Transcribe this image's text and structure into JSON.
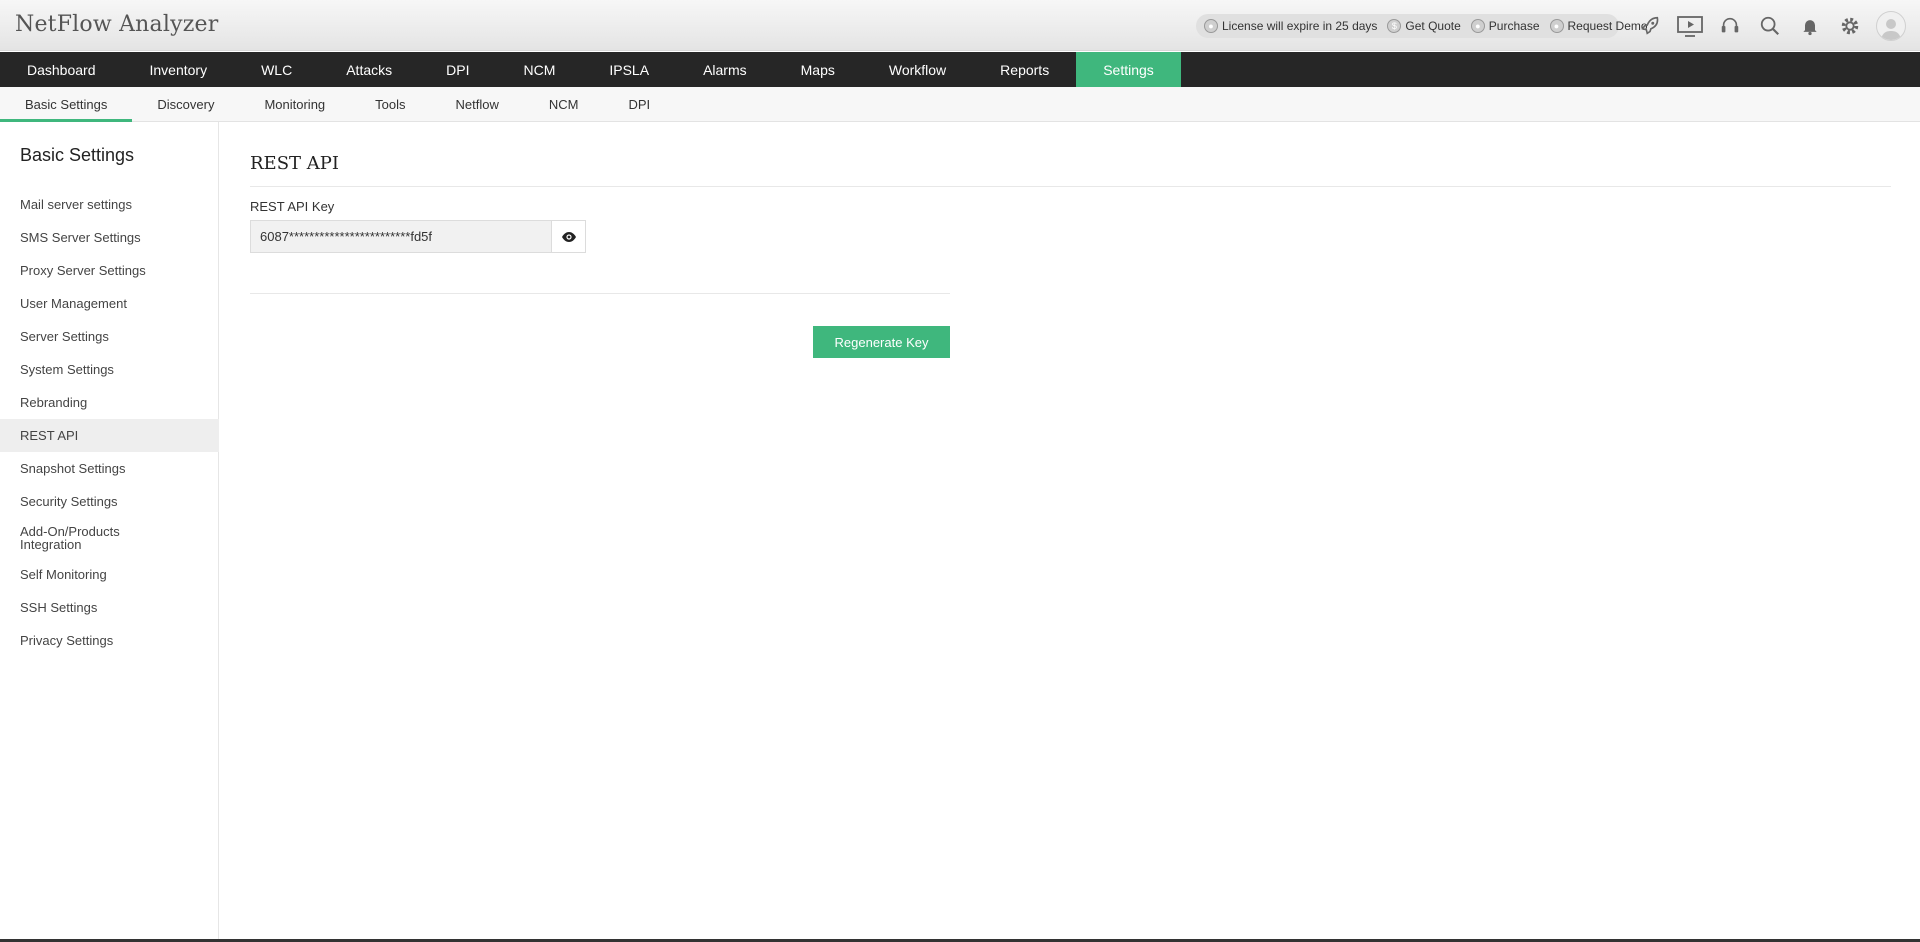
{
  "app": {
    "title": "NetFlow Analyzer"
  },
  "header": {
    "promo": [
      {
        "icon": "license-icon",
        "label": "License will expire in 25 days"
      },
      {
        "icon": "dollar-icon",
        "label": "Get Quote"
      },
      {
        "icon": "cart-icon",
        "label": "Purchase"
      },
      {
        "icon": "demo-icon",
        "label": "Request Demo"
      }
    ],
    "icons": [
      "rocket-icon",
      "video-icon",
      "headset-icon",
      "search-icon",
      "bell-icon",
      "gear-icon",
      "avatar"
    ]
  },
  "main_nav": {
    "items": [
      "Dashboard",
      "Inventory",
      "WLC",
      "Attacks",
      "DPI",
      "NCM",
      "IPSLA",
      "Alarms",
      "Maps",
      "Workflow",
      "Reports",
      "Settings"
    ],
    "active": "Settings"
  },
  "sub_nav": {
    "items": [
      "Basic Settings",
      "Discovery",
      "Monitoring",
      "Tools",
      "Netflow",
      "NCM",
      "DPI"
    ],
    "active": "Basic Settings"
  },
  "sidebar": {
    "title": "Basic Settings",
    "items": [
      "Mail server settings",
      "SMS Server Settings",
      "Proxy Server Settings",
      "User Management",
      "Server Settings",
      "System Settings",
      "Rebranding",
      "REST API",
      "Snapshot Settings",
      "Security Settings",
      "Add-On/Products Integration",
      "Self Monitoring",
      "SSH Settings",
      "Privacy Settings"
    ],
    "active": "REST API"
  },
  "content": {
    "title": "REST API",
    "key_label": "REST API Key",
    "key_value": "6087************************fd5f",
    "regenerate_label": "Regenerate Key"
  },
  "colors": {
    "accent": "#3fb77d",
    "nav_bg": "#262626"
  }
}
